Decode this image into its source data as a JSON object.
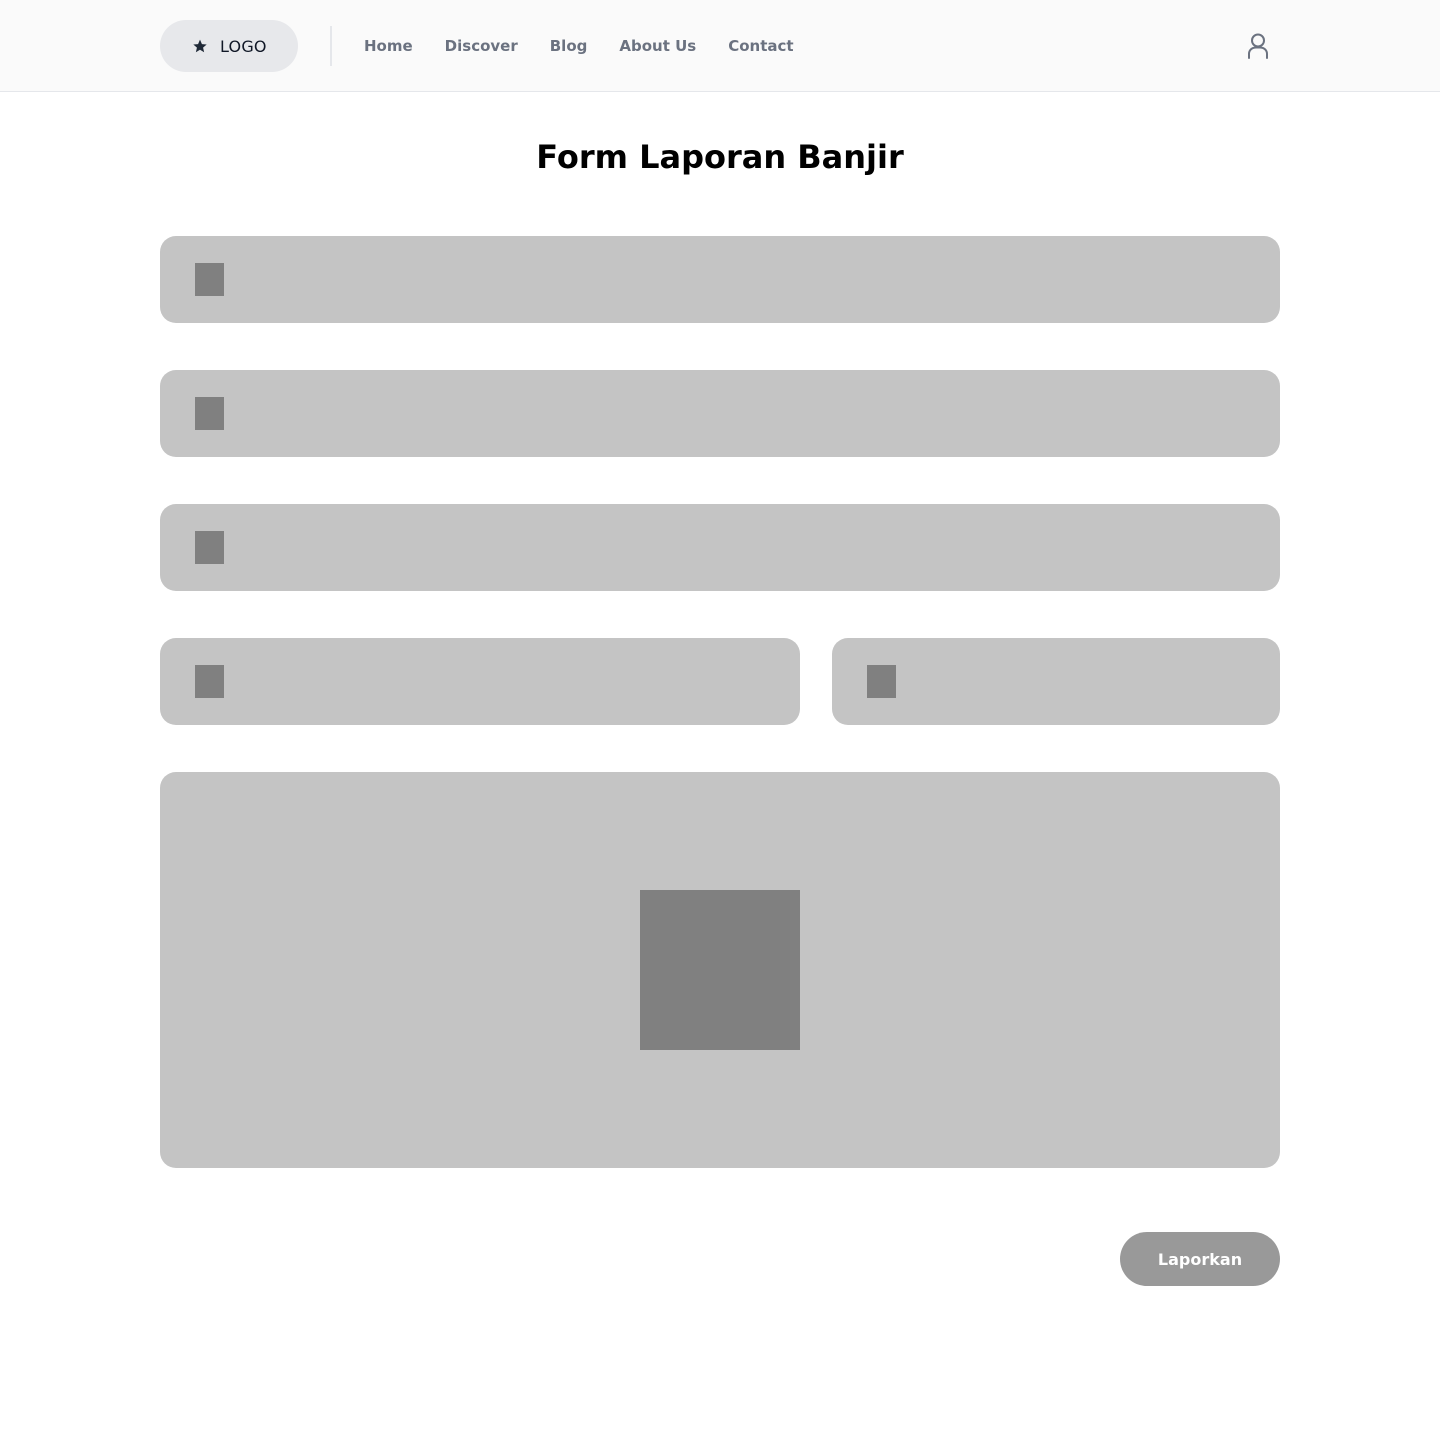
{
  "header": {
    "logo_label": "LOGO",
    "nav": [
      {
        "label": "Home"
      },
      {
        "label": "Discover"
      },
      {
        "label": "Blog"
      },
      {
        "label": "About Us"
      },
      {
        "label": "Contact"
      }
    ],
    "icons": {
      "logo": "star-icon",
      "account": "user-icon"
    }
  },
  "page": {
    "title": "Form Laporan Banjir"
  },
  "form": {
    "submit_label": "Laporkan"
  },
  "colors": {
    "header_bg": "#fafafa",
    "logo_pill_bg": "#e7e8eb",
    "nav_text": "#6b7280",
    "field_bg": "#c4c4c4",
    "placeholder_block": "#808080",
    "button_bg": "#999999",
    "button_text": "#ffffff"
  }
}
